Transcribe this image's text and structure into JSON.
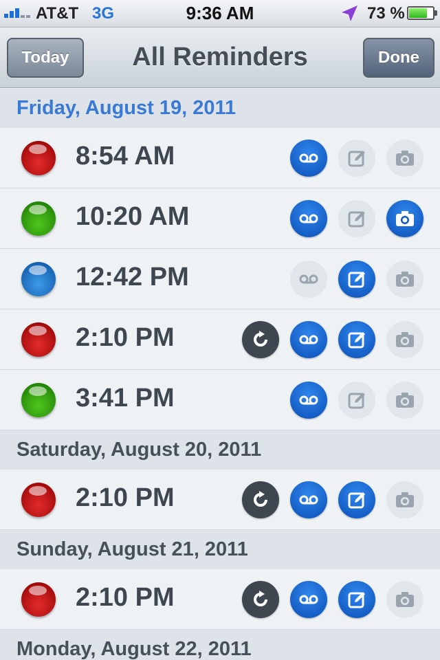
{
  "status_bar": {
    "carrier": "AT&T",
    "network": "3G",
    "time": "9:36 AM",
    "battery_percent": "73 %",
    "battery_level": 0.73,
    "signal_bars": 3
  },
  "nav": {
    "left_button": "Today",
    "title": "All Reminders",
    "right_button": "Done"
  },
  "sections": [
    {
      "date": "Friday, August 19, 2011",
      "reminders": [
        {
          "time": "8:54 AM",
          "color": "red",
          "repeat": false,
          "voice": true,
          "note": false,
          "photo": false
        },
        {
          "time": "10:20 AM",
          "color": "green",
          "repeat": false,
          "voice": true,
          "note": false,
          "photo": true
        },
        {
          "time": "12:42 PM",
          "color": "blue",
          "repeat": false,
          "voice": false,
          "note": true,
          "photo": false
        },
        {
          "time": "2:10 PM",
          "color": "red",
          "repeat": true,
          "voice": true,
          "note": true,
          "photo": false
        },
        {
          "time": "3:41 PM",
          "color": "green",
          "repeat": false,
          "voice": true,
          "note": false,
          "photo": false
        }
      ]
    },
    {
      "date": "Saturday, August 20, 2011",
      "reminders": [
        {
          "time": "2:10 PM",
          "color": "red",
          "repeat": true,
          "voice": true,
          "note": true,
          "photo": false
        }
      ]
    },
    {
      "date": "Sunday, August 21, 2011",
      "reminders": [
        {
          "time": "2:10 PM",
          "color": "red",
          "repeat": true,
          "voice": true,
          "note": true,
          "photo": false
        }
      ]
    },
    {
      "date": "Monday, August 22, 2011",
      "reminders": []
    }
  ],
  "colors": {
    "accent_blue": "#0b4fb6",
    "first_header": "#3a7ad4",
    "repeat_dark": "#3f4650"
  }
}
